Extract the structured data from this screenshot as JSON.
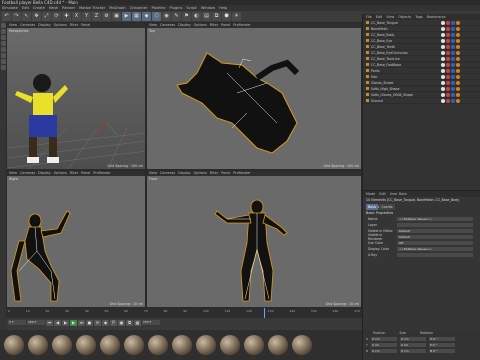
{
  "app": {
    "title": "Football player Bella C4D.c4d * - Main"
  },
  "menubar": [
    "Simulate",
    "Edit",
    "Create",
    "Mesh",
    "Render",
    "Motion Tracker",
    "MoGraph",
    "Character",
    "Pipeline",
    "Plugins",
    "Script",
    "Window",
    "Help"
  ],
  "toolbar": [
    "↶",
    "↷",
    "↖",
    "✥",
    "⤢",
    "⟳",
    "✚",
    "X",
    "Y",
    "Z",
    "⚙",
    "▣",
    "▶",
    "▦",
    "◆",
    "⬡",
    "◉",
    "✎",
    "⚑",
    "◐",
    "▤",
    "⧉",
    "⬢",
    "☀"
  ],
  "viewports": {
    "perspective": {
      "menu": [
        "View",
        "Cameras",
        "Display",
        "Options",
        "Filter",
        "Panel"
      ],
      "label": "Perspective",
      "info": "Grid Spacing : 100 cm"
    },
    "top": {
      "menu": [
        "View",
        "Cameras",
        "Display",
        "Options",
        "Filter",
        "Panel",
        "ProRender"
      ],
      "label": "Top",
      "info": "Grid Spacing : 100 cm"
    },
    "right": {
      "menu": [
        "View",
        "Cameras",
        "Display",
        "Options",
        "Filter",
        "Panel",
        "ProRender"
      ],
      "label": "Right",
      "info": "Grid Spacing : 10 cm"
    },
    "front": {
      "menu": [
        "View",
        "Cameras",
        "Display",
        "Options",
        "Filter",
        "Panel",
        "ProRender"
      ],
      "label": "Front",
      "info": "Grid Spacing : 10 cm"
    }
  },
  "objects": {
    "menu": [
      "File",
      "Edit",
      "View",
      "Objects",
      "Tags",
      "Bookmarks"
    ],
    "items": [
      "CC_Base_Tongue",
      "BoneMesh",
      "CC_Base_Body",
      "CC_Base_Eye",
      "CC_Base_Teeth",
      "CC_Base_EyeOcclusion",
      "CC_Base_TearLine",
      "CC_Base_FootBase",
      "Pants",
      "Hair",
      "Gloves_Shade",
      "Softs_High_Shape",
      "Softs_Gloves_H008_Shape",
      "Ground"
    ],
    "tag_colors": [
      "#e0e0e0",
      "#d04040",
      "#3060c0",
      "#d08020"
    ]
  },
  "attributes": {
    "menu": [
      "Mode",
      "Edit",
      "User Data"
    ],
    "title": "10 Elements [CC_Base_Tongue, BoneMesh, CC_Base_Body, CC_Base_Eye...]",
    "tabs": [
      "Basic",
      "Coords"
    ],
    "section": "Basic Properties",
    "rows": [
      {
        "k": "Name",
        "v": "<<Multiple Values>>"
      },
      {
        "k": "Layer",
        "v": ""
      },
      {
        "k": "Visible in Editor",
        "v": "Default"
      },
      {
        "k": "Visible in Renderer",
        "v": "Default"
      },
      {
        "k": "Use Color",
        "v": "Off"
      },
      {
        "k": "Display Color",
        "v": "<<Multiple Values>>"
      },
      {
        "k": "X-Ray",
        "v": ""
      }
    ]
  },
  "timeline": {
    "ticks": [
      "0",
      "10",
      "20",
      "30",
      "40",
      "50",
      "60",
      "70",
      "80",
      "90",
      "100",
      "110",
      "120",
      "130",
      "140",
      "150",
      "160",
      "170"
    ],
    "current": "0 F",
    "end": "160 F",
    "frame_field": "155 F"
  },
  "transport": [
    "⏮",
    "◀",
    "▶",
    "▶",
    "⏭",
    "●",
    "⟳",
    "◆",
    "P",
    "▣",
    "⧉",
    "▦"
  ],
  "coordinates": {
    "headers": [
      "Position",
      "Size",
      "Rotation"
    ],
    "rows": [
      {
        "axis": "X",
        "p": "0 cm",
        "s": "0 cm",
        "r": "H 0 °"
      },
      {
        "axis": "Y",
        "p": "0 cm",
        "s": "0 cm",
        "r": "P 0 °"
      },
      {
        "axis": "Z",
        "p": "0 cm",
        "s": "0 cm",
        "r": "B 0 °"
      }
    ]
  }
}
